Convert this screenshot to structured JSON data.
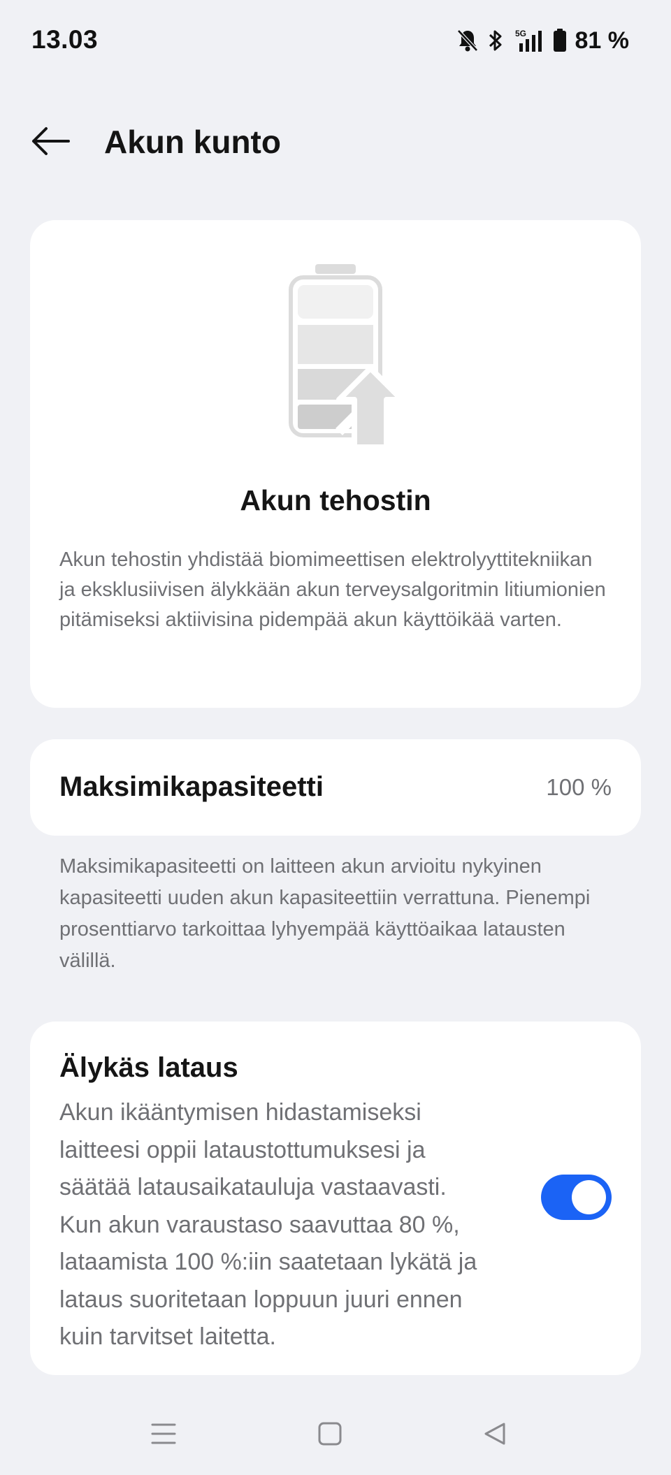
{
  "status_bar": {
    "time": "13.03",
    "network": "5G",
    "battery_percent": "81 %",
    "icons": [
      "bell-off-icon",
      "bluetooth-icon",
      "signal-icon",
      "battery-icon"
    ]
  },
  "header": {
    "back_icon": "arrow-left-icon",
    "title": "Akun kunto"
  },
  "booster_card": {
    "icon": "battery-boost-icon",
    "title": "Akun tehostin",
    "description": "Akun tehostin yhdistää biomimeettisen elektrolyyttitekniikan ja eksklusiivisen älykkään akun terveysalgoritmin litiumionien pitämiseksi aktiivisina pidempää akun käyttöikää varten."
  },
  "capacity": {
    "label": "Maksimikapasiteetti",
    "value": "100 %",
    "note": "Maksimikapasiteetti on laitteen akun arvioitu nykyinen kapasiteetti uuden akun kapasiteettiin verrattuna. Pienempi prosenttiarvo tarkoittaa lyhyempää käyttöaikaa latausten välillä."
  },
  "smart_charging": {
    "title": "Älykäs lataus",
    "description": "Akun ikääntymisen hidastamiseksi laitteesi oppii lataustottumuksesi ja säätää latausaikatauluja vastaavasti. Kun akun varaustaso saavuttaa 80 %, lataamista 100 %:iin saatetaan lykätä ja lataus suoritetaan loppuun juuri ennen kuin tarvitset laitetta.",
    "enabled": true
  },
  "nav_bar": {
    "icons": [
      "menu-icon",
      "home-icon",
      "back-triangle-icon"
    ]
  },
  "colors": {
    "background": "#f0f1f5",
    "card": "#ffffff",
    "accent": "#1b63f5",
    "secondary_text": "#6f7074"
  }
}
